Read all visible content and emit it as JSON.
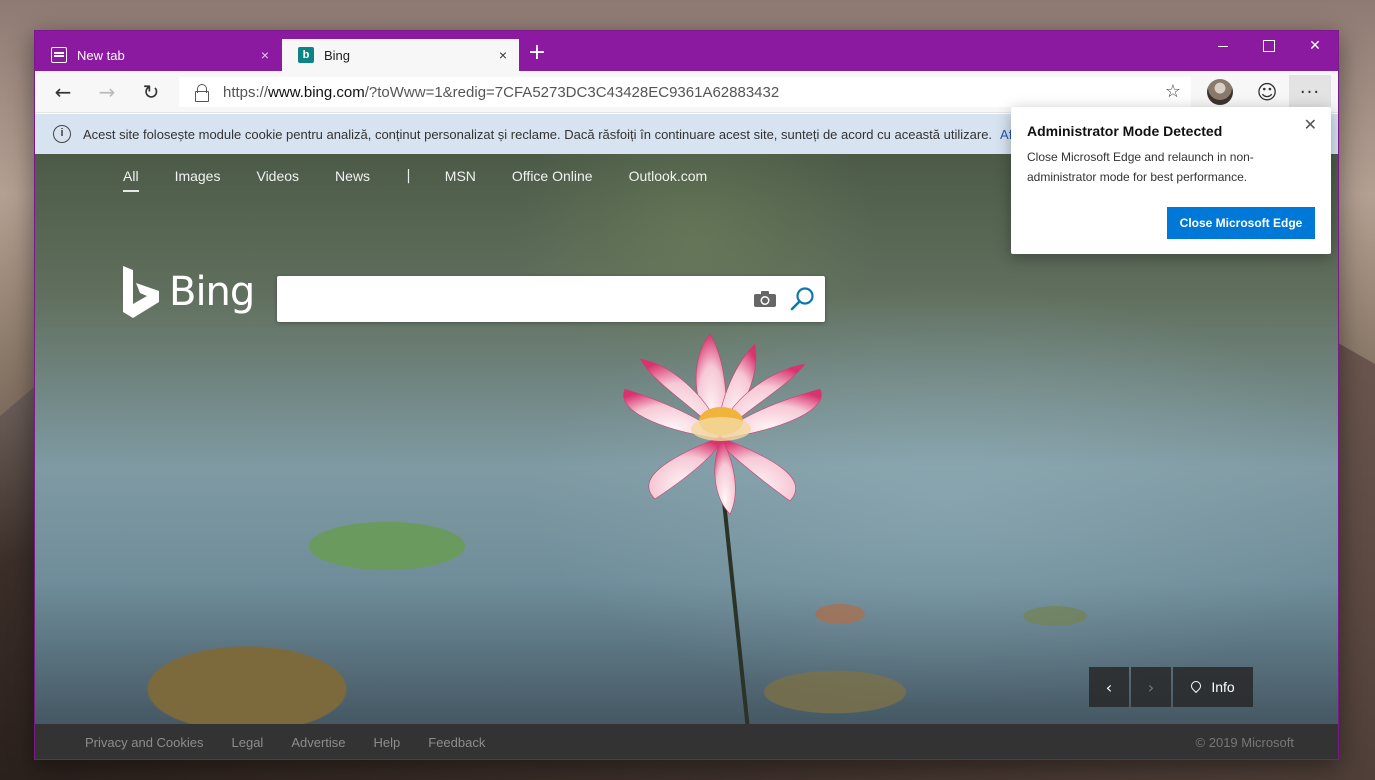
{
  "tabs": [
    {
      "title": "New tab",
      "close": "×"
    },
    {
      "title": "Bing",
      "close": "×"
    }
  ],
  "new_tab": "+",
  "window_controls": {
    "close": "✕"
  },
  "nav": {
    "back": "←",
    "forward": "→",
    "refresh": "↻"
  },
  "address": {
    "scheme": "https://",
    "host": "www.bing.com",
    "path": "/?toWww=1&redig=7CFA5273DC3C43428EC9361A62883432"
  },
  "toolbar": {
    "favorite": "☆",
    "feedback": "☺",
    "more": "···"
  },
  "cookie_banner": {
    "info": "i",
    "text": "Acest site folosește module cookie pentru analiză, conținut personalizat și reclame. Dacă răsfoiți în continuare acest site, sunteți de acord cu această utilizare.",
    "link": "Af"
  },
  "bing_nav": [
    "All",
    "Images",
    "Videos",
    "News",
    "MSN",
    "Office Online",
    "Outlook.com"
  ],
  "bing_nav_sep": "|",
  "bing_logo": "Bing",
  "search": {
    "placeholder": ""
  },
  "image_nav": {
    "prev": "‹",
    "next": "›",
    "info": "Info"
  },
  "footer": {
    "links": [
      "Privacy and Cookies",
      "Legal",
      "Advertise",
      "Help",
      "Feedback"
    ],
    "copyright": "© 2019 Microsoft"
  },
  "popup": {
    "title": "Administrator Mode Detected",
    "message": "Close Microsoft Edge and relaunch in non-administrator mode for best performance.",
    "button": "Close Microsoft Edge",
    "close": "✕"
  },
  "colors": {
    "titlebar": "#8b1aa0",
    "accent_button": "#0078d7",
    "cookie_banner": "#d8e3f1",
    "footer": "#333333"
  }
}
